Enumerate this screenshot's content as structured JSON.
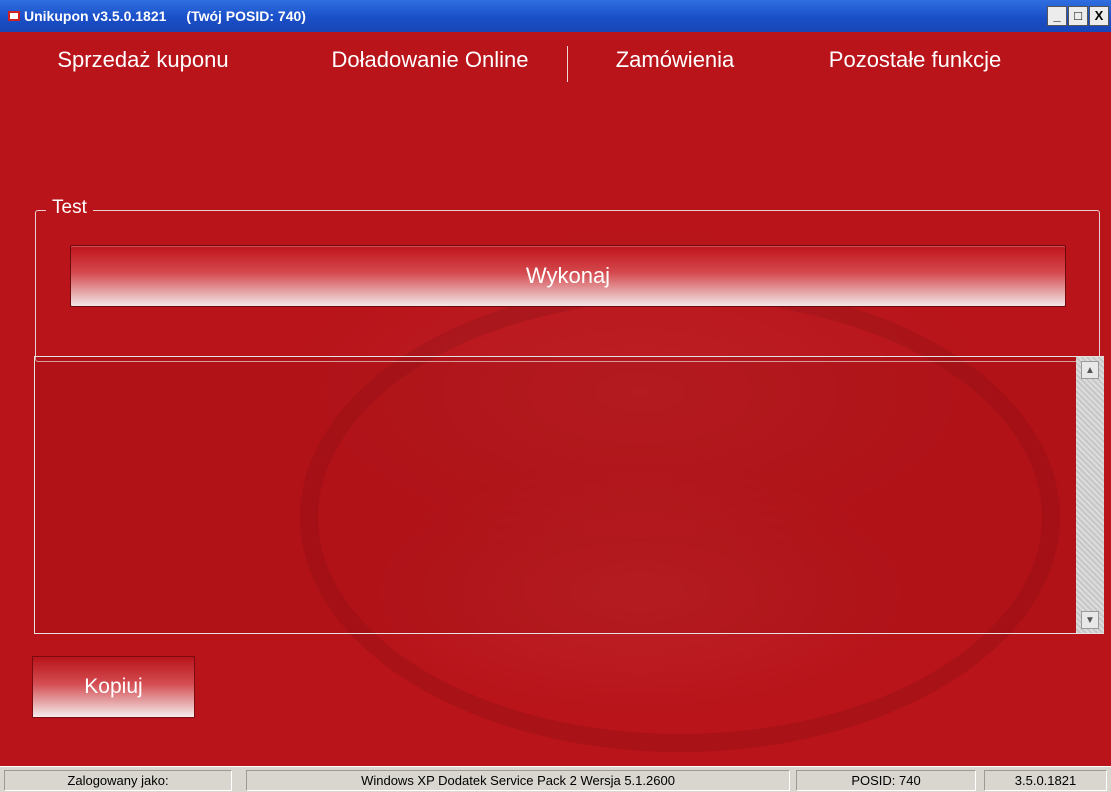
{
  "window": {
    "app_title": "Unikupon v3.5.0.1821",
    "posid_title": "(Twój POSID: 740)",
    "controls": {
      "minimize": "_",
      "maximize": "□",
      "close": "X"
    }
  },
  "menu": {
    "items": [
      {
        "label": "Sprzedaż kuponu"
      },
      {
        "label": "Doładowanie Online"
      },
      {
        "label": "Zamówienia"
      },
      {
        "label": "Pozostałe funkcje"
      }
    ]
  },
  "test_group": {
    "legend": "Test",
    "execute_label": "Wykonaj"
  },
  "output": {
    "text": ""
  },
  "copy_label": "Kopiuj",
  "statusbar": {
    "logged_in": "Zalogowany jako:",
    "os": "Windows XP Dodatek Service Pack 2 Wersja 5.1.2600",
    "posid": "POSID:  740",
    "version": "3.5.0.1821"
  },
  "colors": {
    "background": "#b8141a",
    "titlebar": "#1a4fc8",
    "statusbar": "#d9d6cf"
  }
}
